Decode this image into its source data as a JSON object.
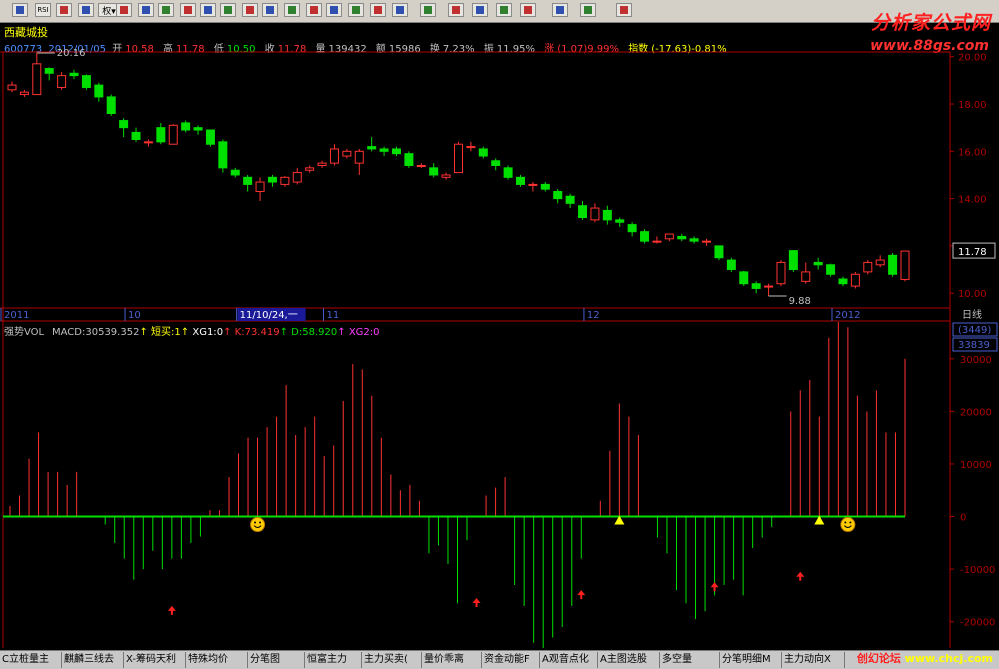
{
  "toolbar": {
    "tools": [
      "home-icon",
      "rsi-icon",
      "move-icon",
      "arrow-icon",
      "rights-select",
      "glasses-icon",
      "compare-icon",
      "disk-icon",
      "chart-grid-icon",
      "k-icon",
      "search-icon",
      "bell-icon",
      "sheet-icon",
      "board-icon",
      "list-icon",
      "panel-icon",
      "panel2-icon",
      "cursor-icon",
      "line-icon",
      "hline-icon",
      "bars-icon",
      "fan-icon",
      "gann-icon",
      "parallel-icon",
      "rect-icon",
      "ellipse-icon",
      "text-icon"
    ],
    "rights_label": "权",
    "rsi_label": "RSI"
  },
  "logo": {
    "title": "分析家公式网",
    "url": "www.88gs.com"
  },
  "stock": {
    "name": "西藏城投"
  },
  "info": {
    "code": "600773",
    "date": "2012/01/05",
    "open_l": "开",
    "open": "10.58",
    "high_l": "高",
    "high": "11.78",
    "low_l": "低",
    "low": "10.50",
    "close_l": "收",
    "close": "11.78",
    "vol_l": "量",
    "vol": "139432",
    "amt_l": "额",
    "amt": "15986",
    "turn_l": "换",
    "turn": "7.23%",
    "amp_l": "振",
    "amp": "11.95%",
    "chg_l": "涨",
    "chg": "(1.07)9.99%",
    "idx_l": "指数",
    "idx": "(-17.63)-0.81%"
  },
  "price_panel": {
    "max_label": "20.16",
    "min_label": "9.88",
    "last_price": "11.78",
    "axis": [
      "20.00",
      "18.00",
      "16.00",
      "14.00",
      "12.00",
      "10.00"
    ],
    "period_label": "日线"
  },
  "time_axis": {
    "labels": [
      "2011",
      "10",
      "11/10/24,一",
      "11",
      "12",
      "2012"
    ]
  },
  "indicator": {
    "name": "强势VOL",
    "macd_l": "MACD:",
    "macd": "30539.352",
    "short_l": "短买:",
    "short": "1",
    "xg1_l": "XG1:",
    "xg1": "0",
    "k_l": "K:",
    "k": "73.419",
    "d_l": "D:",
    "d": "58.920",
    "xg2_l": "XG2:",
    "xg2": "0",
    "box1": "(3449)",
    "box2": "33839",
    "axis": [
      "30000",
      "20000",
      "10000",
      "0",
      "-10000",
      "-20000"
    ]
  },
  "footer": {
    "tabs": [
      "C立桩量主",
      "麒麟三线去",
      "X-筹码天利",
      "特殊均价",
      "分笔图",
      "恒富主力",
      "主力买卖(",
      "量价乖离",
      "资金动能F",
      "A观音点化",
      "A主图选股",
      "多空量",
      "分笔明细M",
      "主力动向X"
    ]
  },
  "watermark": {
    "a": "创幻论坛",
    "b": "www.chcj.com"
  },
  "colors": {
    "up": "#ff3232",
    "down": "#00e000",
    "axis": "#b00000",
    "info_label": "#c0c0c0"
  },
  "chart_data": {
    "type": "candlestick",
    "price": {
      "ylim": [
        9.5,
        20.2
      ],
      "candles": [
        [
          18.6,
          18.8,
          18.95,
          18.5
        ],
        [
          18.4,
          18.5,
          18.6,
          18.3
        ],
        [
          18.4,
          19.7,
          20.16,
          18.4
        ],
        [
          19.5,
          19.3,
          19.55,
          19.0
        ],
        [
          18.7,
          19.2,
          19.35,
          18.6
        ],
        [
          19.3,
          19.2,
          19.45,
          19.05
        ],
        [
          19.2,
          18.7,
          19.25,
          18.6
        ],
        [
          18.8,
          18.3,
          18.9,
          18.1
        ],
        [
          18.3,
          17.6,
          18.4,
          17.5
        ],
        [
          17.3,
          17.0,
          17.4,
          16.6
        ],
        [
          16.8,
          16.5,
          17.0,
          16.4
        ],
        [
          16.4,
          16.4,
          16.5,
          16.2
        ],
        [
          17.0,
          16.4,
          17.2,
          16.3
        ],
        [
          16.3,
          17.1,
          17.15,
          16.3
        ],
        [
          17.2,
          16.9,
          17.3,
          16.8
        ],
        [
          17.0,
          16.9,
          17.1,
          16.7
        ],
        [
          16.9,
          16.3,
          16.9,
          16.2
        ],
        [
          16.4,
          15.3,
          16.5,
          15.1
        ],
        [
          15.2,
          15.0,
          15.3,
          14.9
        ],
        [
          14.9,
          14.6,
          15.0,
          14.3
        ],
        [
          14.3,
          14.7,
          14.9,
          13.9
        ],
        [
          14.9,
          14.7,
          15.0,
          14.5
        ],
        [
          14.6,
          14.9,
          14.95,
          14.5
        ],
        [
          14.7,
          15.1,
          15.3,
          14.6
        ],
        [
          15.2,
          15.3,
          15.4,
          15.1
        ],
        [
          15.4,
          15.5,
          15.6,
          15.3
        ],
        [
          15.5,
          16.1,
          16.3,
          15.4
        ],
        [
          15.8,
          16.0,
          16.1,
          15.7
        ],
        [
          15.5,
          16.0,
          16.1,
          15.0
        ],
        [
          16.2,
          16.1,
          16.6,
          16.0
        ],
        [
          16.1,
          16.0,
          16.2,
          15.8
        ],
        [
          16.1,
          15.9,
          16.2,
          15.8
        ],
        [
          15.9,
          15.4,
          16.0,
          15.3
        ],
        [
          15.4,
          15.4,
          15.5,
          15.3
        ],
        [
          15.3,
          15.0,
          15.5,
          14.9
        ],
        [
          14.9,
          15.0,
          15.1,
          14.8
        ],
        [
          15.1,
          16.3,
          16.4,
          15.1
        ],
        [
          16.2,
          16.2,
          16.4,
          16.0
        ],
        [
          16.1,
          15.8,
          16.2,
          15.7
        ],
        [
          15.6,
          15.4,
          15.7,
          15.2
        ],
        [
          15.3,
          14.9,
          15.4,
          14.8
        ],
        [
          14.9,
          14.6,
          15.0,
          14.5
        ],
        [
          14.6,
          14.6,
          14.7,
          14.3
        ],
        [
          14.6,
          14.4,
          14.7,
          14.3
        ],
        [
          14.3,
          14.0,
          14.4,
          13.8
        ],
        [
          14.1,
          13.8,
          14.2,
          13.6
        ],
        [
          13.7,
          13.2,
          13.9,
          13.1
        ],
        [
          13.1,
          13.6,
          13.8,
          13.0
        ],
        [
          13.5,
          13.1,
          13.7,
          12.9
        ],
        [
          13.1,
          13.0,
          13.2,
          12.8
        ],
        [
          12.9,
          12.6,
          13.0,
          12.4
        ],
        [
          12.6,
          12.2,
          12.7,
          12.1
        ],
        [
          12.2,
          12.2,
          12.4,
          12.1
        ],
        [
          12.3,
          12.5,
          12.5,
          12.2
        ],
        [
          12.4,
          12.3,
          12.5,
          12.2
        ],
        [
          12.3,
          12.2,
          12.4,
          12.1
        ],
        [
          12.2,
          12.2,
          12.3,
          12.0
        ],
        [
          12.0,
          11.5,
          12.0,
          11.4
        ],
        [
          11.4,
          11.0,
          11.5,
          10.9
        ],
        [
          10.9,
          10.4,
          10.95,
          10.3
        ],
        [
          10.4,
          10.2,
          10.5,
          10.0
        ],
        [
          10.3,
          10.3,
          10.4,
          9.88
        ],
        [
          10.4,
          11.3,
          11.4,
          10.3
        ],
        [
          11.8,
          11.0,
          11.8,
          10.9
        ],
        [
          10.5,
          10.9,
          11.3,
          10.4
        ],
        [
          11.3,
          11.2,
          11.5,
          11.0
        ],
        [
          11.2,
          10.8,
          11.25,
          10.7
        ],
        [
          10.6,
          10.4,
          10.7,
          10.3
        ],
        [
          10.3,
          10.8,
          10.9,
          10.2
        ],
        [
          10.9,
          11.3,
          11.4,
          10.8
        ],
        [
          11.2,
          11.4,
          11.6,
          11.1
        ],
        [
          11.6,
          10.8,
          11.7,
          10.7
        ],
        [
          10.58,
          11.78,
          11.78,
          10.5
        ]
      ]
    },
    "indicator": {
      "ylim": [
        -25000,
        37000
      ],
      "values": [
        2000,
        4000,
        11000,
        16000,
        8500,
        8500,
        6000,
        8500,
        0,
        0,
        -1500,
        -5000,
        -8000,
        -12000,
        -10000,
        -6500,
        -10000,
        -8000,
        -8000,
        -5000,
        -3800,
        1200,
        1200,
        7500,
        12000,
        15000,
        15000,
        17000,
        19000,
        25000,
        15500,
        17000,
        19000,
        11500,
        13500,
        22000,
        29000,
        28000,
        23000,
        15000,
        8000,
        5000,
        6000,
        3000,
        -7000,
        -5500,
        -9000,
        -16500,
        -4500,
        0,
        4000,
        5500,
        7500,
        -13000,
        -17000,
        -24000,
        -25000,
        -23000,
        -21000,
        -17000,
        -8000,
        0,
        3000,
        12500,
        21500,
        19000,
        15500,
        0,
        -4000,
        -7000,
        -14000,
        -16500,
        -19500,
        -18000,
        -15000,
        -13000,
        -12000,
        -15000,
        -6000,
        -4000,
        -2000,
        0,
        20000,
        24000,
        26000,
        19000,
        34000,
        37000,
        36000,
        23000,
        20000,
        24000,
        16000,
        16000,
        30000
      ],
      "markers": [
        {
          "type": "arrow",
          "index": 12
        },
        {
          "type": "smile",
          "index": 20
        },
        {
          "type": "arrow",
          "index": 36
        },
        {
          "type": "arrow",
          "index": 44
        },
        {
          "type": "triangle",
          "index": 47
        },
        {
          "type": "arrow",
          "index": 54
        },
        {
          "type": "arrow",
          "index": 61
        },
        {
          "type": "triangle",
          "index": 62
        },
        {
          "type": "smile",
          "index": 70
        }
      ]
    }
  }
}
